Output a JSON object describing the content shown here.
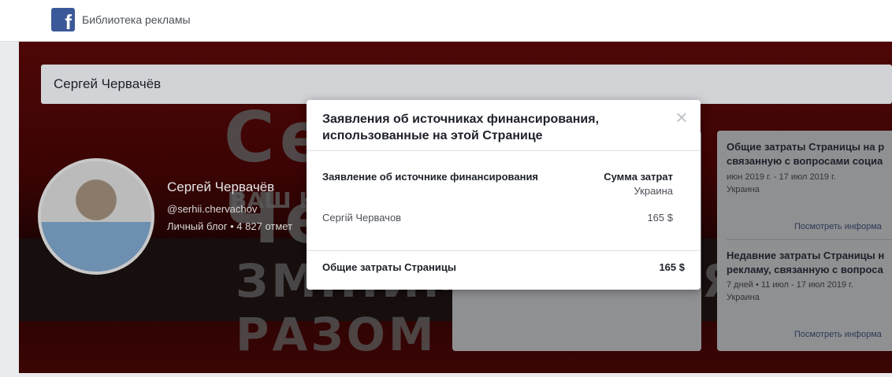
{
  "header": {
    "brand": "Библиотека рекламы",
    "logo_letter": "f"
  },
  "search": {
    "value": "Сергей Червачёв"
  },
  "cover": {
    "big_text": "Сергей Червачёв",
    "mid_text": "ВАШ КАНДИДАТ ... ОКРУГУ №140",
    "bottom_text": "ЗМІНИМО ЖИТТЯ РАЗОМ"
  },
  "profile": {
    "name": "Сергей Червачёв",
    "handle": "@serhii.chervachov",
    "meta": "Личный блог • 4 827 отмет"
  },
  "side_card": {
    "block1_title_l1": "Общие затраты Страницы на р",
    "block1_title_l2": "связанную с вопросами социа",
    "block1_dates": "июн 2019 г. - 17 июл 2019 г.",
    "block1_country": "Украина",
    "block1_link": "Посмотреть информа",
    "block2_title_l1": "Недавние затраты Страницы н",
    "block2_title_l2": "рекламу, связанную с вопроса",
    "block2_dates": "7 дней • 11 июл - 17 июл 2019 г.",
    "block2_country": "Украина",
    "block2_link": "Посмотреть информа"
  },
  "modal": {
    "title": "Заявления об источниках финансирования, использованные на этой Странице",
    "close": "×",
    "col_source": "Заявление об источнике финансирования",
    "col_amount": "Сумма затрат",
    "col_amount_sub": "Украина",
    "rows": [
      {
        "name": "Сергій Червачов",
        "amount": "165 $"
      }
    ],
    "total_label": "Общие затраты Страницы",
    "total_amount": "165 $"
  },
  "colors": {
    "fb_blue": "#3b5998",
    "cover_red": "#8e0d0d"
  }
}
